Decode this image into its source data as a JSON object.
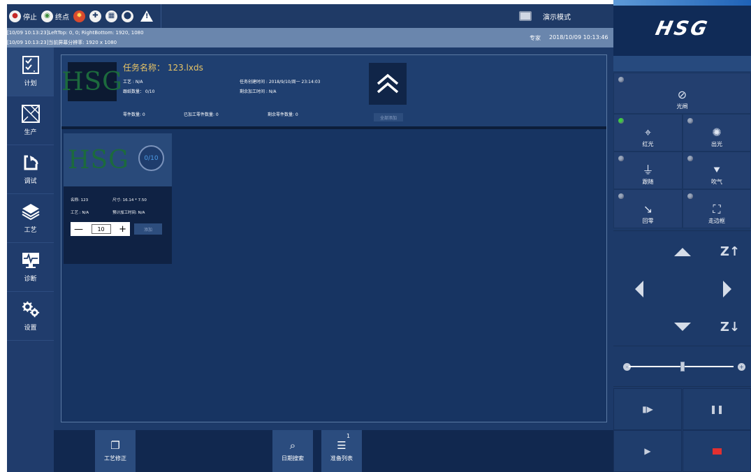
{
  "toolbar": {
    "stop_label": "停止",
    "endpoint_label": "终点",
    "mode_label": "演示模式"
  },
  "info": {
    "line1": "[10/09 10:13:23]LeftTop: 0, 0; RightBottom: 1920, 1080",
    "line2": "[10/09 10:13:23]当前屏幕分辨率: 1920 x 1080",
    "role": "专家",
    "datetime": "2018/10/09  10:13:46"
  },
  "brand": {
    "logo": "HSG"
  },
  "sidebar": {
    "items": [
      {
        "label": "计划",
        "icon": "checklist-icon"
      },
      {
        "label": "生产",
        "icon": "layout-icon"
      },
      {
        "label": "调试",
        "icon": "refresh-icon"
      },
      {
        "label": "工艺",
        "icon": "layers-icon"
      },
      {
        "label": "诊断",
        "icon": "monitor-pulse-icon"
      },
      {
        "label": "设置",
        "icon": "gears-icon"
      }
    ]
  },
  "task": {
    "logo_text": "HSG",
    "title": "任务名称： 123.lxds",
    "craft": "工艺 : N/A",
    "nest_count": "跟纸数量： 0/10",
    "created": "任务创建时间 : 2018/9/10/周一 23:14:03",
    "remaining_time": "剩余加工时间 : N/A",
    "part_count": "零件数量: 0",
    "done_count": "已加工零件数量: 0",
    "left_count": "剩余零件数量: 0",
    "all_button": "全部添加"
  },
  "card": {
    "logo_text": "HSG",
    "progress": "0/10",
    "name": "名称: 123",
    "size": "尺寸: 16.14 * 7.50",
    "craft": "工艺 : N/A",
    "estimate": "预计加工时间: N/A",
    "quantity": "10",
    "add_button": "添加"
  },
  "bottombar": {
    "buttons": [
      {
        "label": "工艺修正",
        "icon": "copy-icon"
      },
      {
        "label": "日期搜索",
        "icon": "search-icon"
      },
      {
        "label": "准备列表",
        "icon": "list-icon",
        "badge": "1"
      }
    ]
  },
  "rpanel": {
    "shutter": "光闸",
    "red_light": "红光",
    "beam": "出光",
    "follow": "跟随",
    "blow": "吹气",
    "return": "回零",
    "frame": "走边框",
    "z_up": "Z↑",
    "z_down": "Z↓"
  },
  "colors": {
    "panel": "#1d3a69",
    "accent_gold": "#e8c466",
    "indicator_on": "#3ecf3e",
    "stop_red": "#e23030"
  }
}
